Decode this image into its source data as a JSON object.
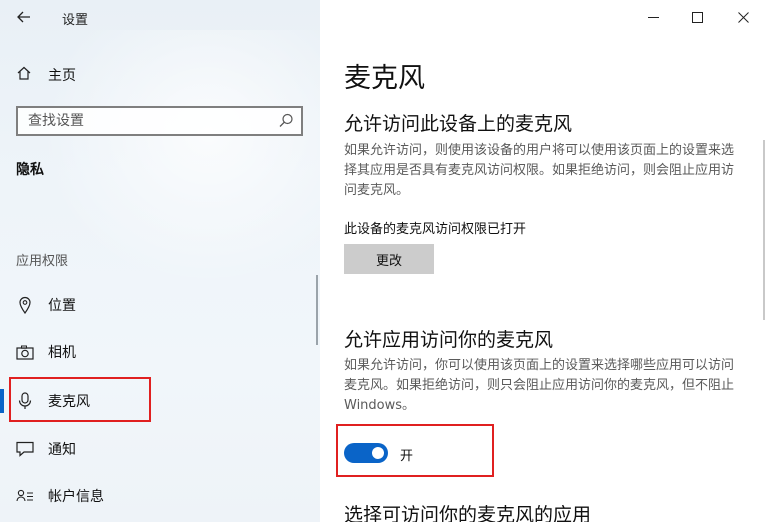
{
  "app": {
    "title": "设置"
  },
  "sidebar": {
    "home_label": "主页",
    "search_placeholder": "查找设置",
    "section_title": "隐私",
    "group_label": "应用权限",
    "items": [
      {
        "label": "位置",
        "icon": "location-pin-icon"
      },
      {
        "label": "相机",
        "icon": "camera-icon"
      },
      {
        "label": "麦克风",
        "icon": "microphone-icon",
        "selected": true
      },
      {
        "label": "通知",
        "icon": "notification-icon"
      },
      {
        "label": "帐户信息",
        "icon": "account-info-icon"
      }
    ]
  },
  "main": {
    "page_title": "麦克风",
    "device_section": {
      "heading": "允许访问此设备上的麦克风",
      "description": "如果允许访问，则使用该设备的用户将可以使用该页面上的设置来选择其应用是否具有麦克风访问权限。如果拒绝访问，则会阻止应用访问麦克风。",
      "status": "此设备的麦克风访问权限已打开",
      "change_button": "更改"
    },
    "app_section": {
      "heading": "允许应用访问你的麦克风",
      "description": "如果允许访问，你可以使用该页面上的设置来选择哪些应用可以访问麦克风。如果拒绝访问，则只会阻止应用访问你的麦克风，但不阻止 Windows。",
      "toggle_label": "开",
      "toggle_on": true
    },
    "choose_section": {
      "heading": "选择可访问你的麦克风的应用"
    }
  },
  "colors": {
    "accent": "#0a64c8",
    "highlight_box": "#e02020"
  }
}
